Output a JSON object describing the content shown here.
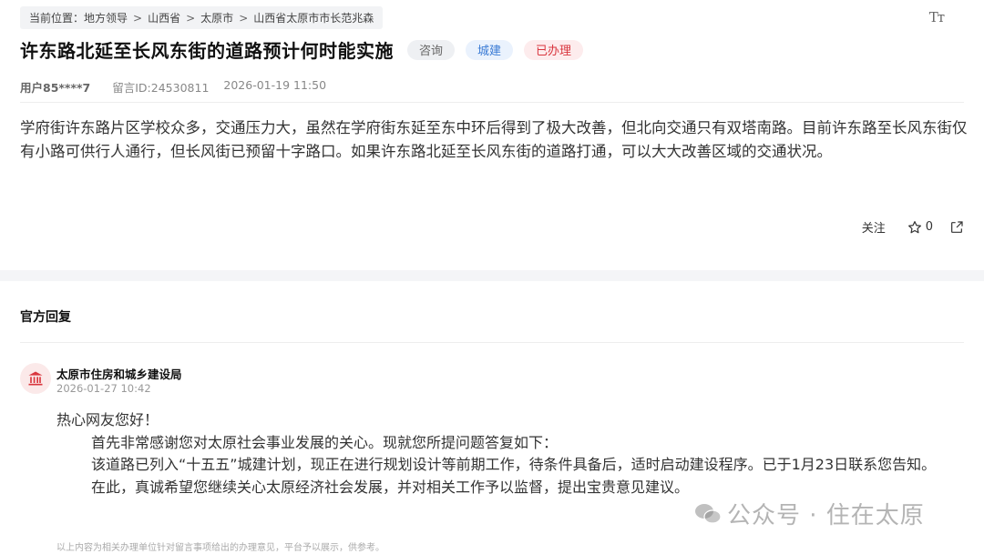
{
  "breadcrumb": {
    "prefix": "当前位置：",
    "items": [
      "地方领导",
      "山西省",
      "太原市",
      "山西省太原市市长范兆森"
    ],
    "separator": ">"
  },
  "font_toggle": "Tт",
  "message": {
    "title": "许东路北延至长风东街的道路预计何时能实施",
    "tags": {
      "consult": "咨询",
      "build": "城建",
      "done": "已办理"
    },
    "user": "用户85****7",
    "message_id": "留言ID:24530811",
    "datetime": "2026-01-19 11:50",
    "content": "学府街许东路片区学校众多，交通压力大，虽然在学府街东延至东中环后得到了极大改善，但北向交通只有双塔南路。目前许东路至长风东街仅有小路可供行人通行，但长风街已预留十字路口。如果许东路北延至长风东街的道路打通，可以大大改善区域的交通状况。"
  },
  "actions": {
    "follow": "关注",
    "star_count": "0"
  },
  "reply": {
    "heading": "官方回复",
    "org": "太原市住房和城乡建设局",
    "time": "2026-01-27 10:42",
    "greeting": "热心网友您好！",
    "para1": "首先非常感谢您对太原社会事业发展的关心。现就您所提问题答复如下：",
    "para2": "该道路已列入“十五五”城建计划，现正在进行规划设计等前期工作，待条件具备后，适时启动建设程序。已于1月23日联系您告知。",
    "para3": "在此，真诚希望您继续关心太原经济社会发展，并对相关工作予以监督，提出宝贵意见建议。",
    "disclaimer": "以上内容为相关办理单位针对留言事项给出的办理意见，平台予以展示，供参考。"
  },
  "watermark": "公众号 · 住在太原",
  "colors": {
    "tag_build": "#3a7bd5",
    "tag_done": "#d9363e",
    "avatar_bg": "#fbe9e9",
    "avatar_icon": "#d9363e"
  }
}
